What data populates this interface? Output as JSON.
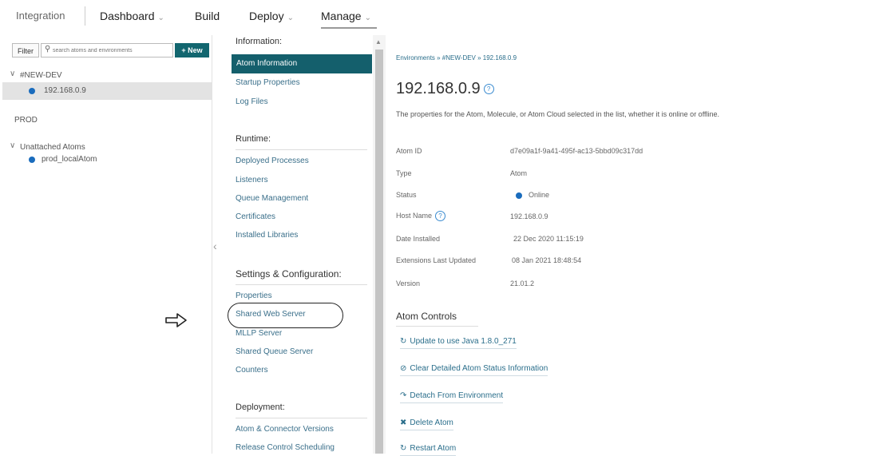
{
  "nav": {
    "integration": "Integration",
    "dashboard": "Dashboard",
    "build": "Build",
    "deploy": "Deploy",
    "manage": "Manage",
    "caret": "⌄"
  },
  "left": {
    "filter_label": "Filter",
    "search_placeholder": "search atoms and environments",
    "new_label": "+ New",
    "tree": {
      "env1": "#NEW-DEV",
      "env1_atom": "192.168.0.9",
      "env2": "PROD",
      "unattached": "Unattached Atoms",
      "unattached_atom": "prod_localAtom"
    }
  },
  "menu": {
    "information_heading": "Information:",
    "information_items": [
      "Atom Information",
      "Startup Properties",
      "Log Files"
    ],
    "runtime_heading": "Runtime:",
    "runtime_items": [
      "Deployed Processes",
      "Listeners",
      "Queue Management",
      "Certificates",
      "Installed Libraries"
    ],
    "settings_heading": "Settings & Configuration:",
    "settings_items": [
      "Properties",
      "Shared Web Server",
      "MLLP Server",
      "Shared Queue Server",
      "Counters"
    ],
    "deployment_heading": "Deployment:",
    "deployment_items": [
      "Atom & Connector Versions",
      "Release Control Scheduling"
    ]
  },
  "detail": {
    "breadcrumb": "Environments » #NEW-DEV » 192.168.0.9",
    "title": "192.168.0.9",
    "description": "The properties for the Atom, Molecule, or Atom Cloud selected in the list, whether it is online or offline.",
    "props": [
      {
        "label": "Atom ID",
        "value": "d7e09a1f-9a41-495f-ac13-5bbd09c317dd"
      },
      {
        "label": "Type",
        "value": "Atom"
      },
      {
        "label": "Status",
        "value": "Online"
      },
      {
        "label": "Host Name",
        "value": "192.168.0.9"
      },
      {
        "label": "Date Installed",
        "value": "22 Dec 2020 11:15:19"
      },
      {
        "label": "Extensions Last Updated",
        "value": "08 Jan 2021 18:48:54"
      },
      {
        "label": "Version",
        "value": "21.01.2"
      }
    ],
    "controls_heading": "Atom Controls",
    "controls": [
      {
        "icon": "↻",
        "label": "Update to use Java 1.8.0_271"
      },
      {
        "icon": "⊘",
        "label": "Clear Detailed Atom Status Information"
      },
      {
        "icon": "↷",
        "label": "Detach From Environment"
      },
      {
        "icon": "✖",
        "label": "Delete Atom"
      },
      {
        "icon": "↻",
        "label": "Restart Atom"
      }
    ]
  },
  "colors": {
    "accent": "#145f6c",
    "link": "#2a6e8b",
    "online": "#1a6cbd"
  }
}
